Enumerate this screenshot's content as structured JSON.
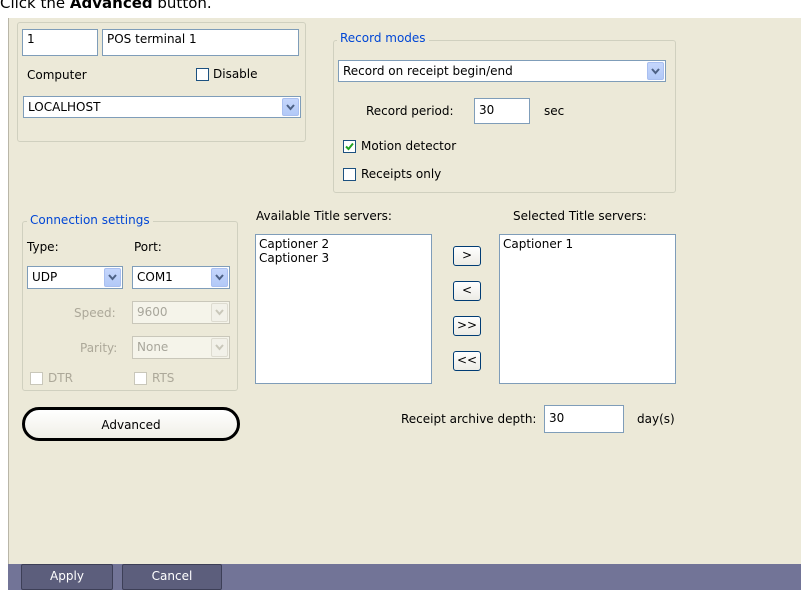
{
  "instruction": {
    "prefix": "Click the ",
    "bold": "Advanced",
    "suffix": " button."
  },
  "terminal": {
    "id_value": "1",
    "name_value": "POS terminal 1",
    "computer_label": "Computer",
    "disable_label": "Disable",
    "computer_value": "LOCALHOST"
  },
  "record_modes": {
    "group_label": "Record modes",
    "mode_value": "Record on receipt begin/end",
    "period_label": "Record period:",
    "period_value": "30",
    "period_unit": "sec",
    "motion_label": "Motion detector",
    "motion_checked": true,
    "receipts_label": "Receipts only",
    "receipts_checked": false
  },
  "connection": {
    "group_label": "Connection settings",
    "type_label": "Type:",
    "port_label": "Port:",
    "type_value": "UDP",
    "port_value": "COM1",
    "speed_label": "Speed:",
    "speed_value": "9600",
    "parity_label": "Parity:",
    "parity_value": "None",
    "dtr_label": "DTR",
    "rts_label": "RTS"
  },
  "servers": {
    "available_label": "Available Title servers:",
    "available_items": [
      "Captioner 2",
      "Captioner 3"
    ],
    "selected_label": "Selected Title servers:",
    "selected_items": [
      "Captioner 1"
    ],
    "add_label": ">",
    "remove_label": "<",
    "add_all_label": ">>",
    "remove_all_label": "<<"
  },
  "advanced_label": "Advanced",
  "archive": {
    "label": "Receipt archive depth:",
    "value": "30",
    "unit": "day(s)"
  },
  "footer": {
    "apply_label": "Apply",
    "cancel_label": "Cancel"
  },
  "colors": {
    "panel": "#ece9d8",
    "bottom_bar": "#727497",
    "group_label": "#0046d5",
    "field_border": "#7f9db9"
  }
}
